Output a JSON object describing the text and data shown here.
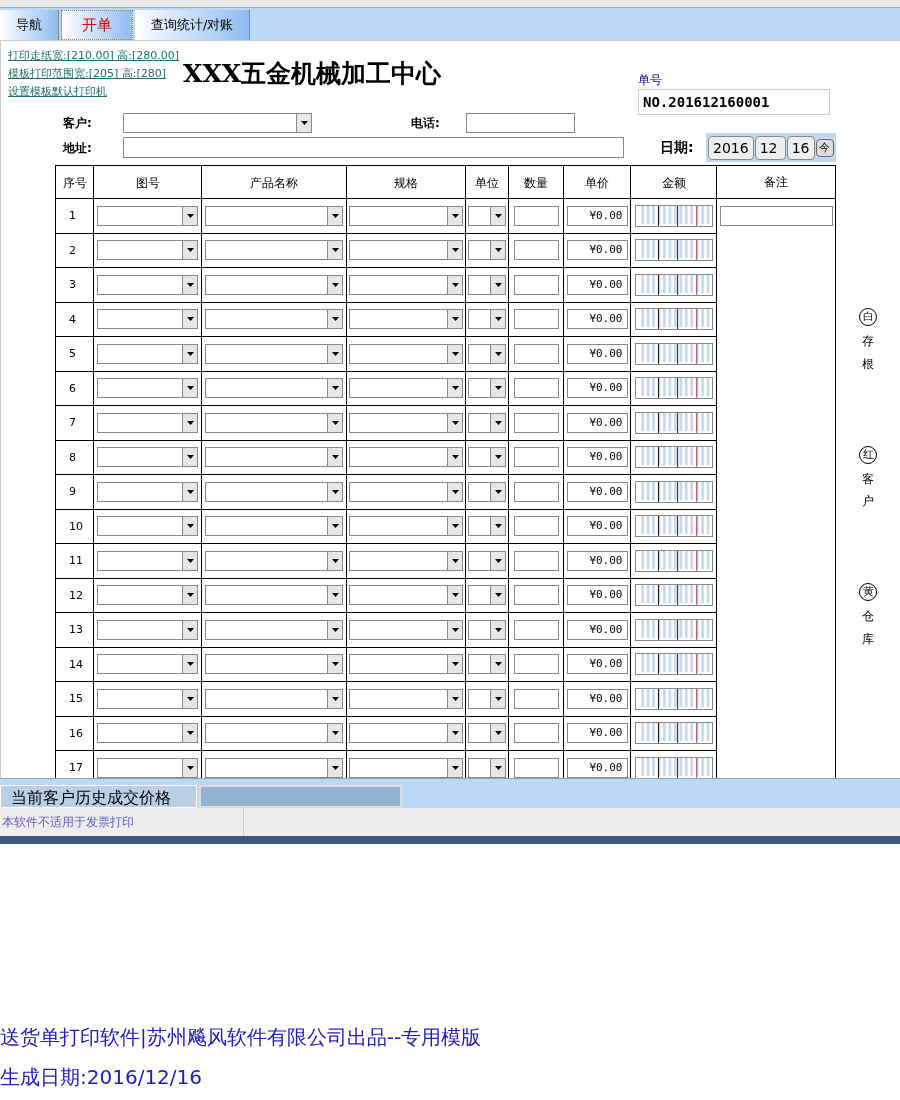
{
  "tabs": [
    {
      "label": "导航",
      "selected": false
    },
    {
      "label": "开单",
      "selected": true
    },
    {
      "label": "查询统计/对账",
      "selected": false
    }
  ],
  "print_links": [
    "打印走纸宽:[210.00] 高:[280.00]",
    "模板打印范围宽:[205] 高:[280]",
    "设置模板默认打印机"
  ],
  "title": "XXX五金机械加工中心",
  "order_no": {
    "label": "单号",
    "value": "NO.201612160001"
  },
  "customer": {
    "label": "客户:"
  },
  "phone": {
    "label": "电话:"
  },
  "address": {
    "label": "地址:"
  },
  "date": {
    "label": "日期:",
    "year": "2016",
    "month": "12",
    "day": "16",
    "today": "今"
  },
  "columns": [
    "序号",
    "图号",
    "产品名称",
    "规格",
    "单位",
    "数量",
    "单价",
    "金额",
    "备注"
  ],
  "rows": [
    {
      "no": "1",
      "price": "¥0.00"
    },
    {
      "no": "2",
      "price": "¥0.00"
    },
    {
      "no": "3",
      "price": "¥0.00"
    },
    {
      "no": "4",
      "price": "¥0.00"
    },
    {
      "no": "5",
      "price": "¥0.00"
    },
    {
      "no": "6",
      "price": "¥0.00"
    },
    {
      "no": "7",
      "price": "¥0.00"
    },
    {
      "no": "8",
      "price": "¥0.00"
    },
    {
      "no": "9",
      "price": "¥0.00"
    },
    {
      "no": "10",
      "price": "¥0.00"
    },
    {
      "no": "11",
      "price": "¥0.00"
    },
    {
      "no": "12",
      "price": "¥0.00"
    },
    {
      "no": "13",
      "price": "¥0.00"
    },
    {
      "no": "14",
      "price": "¥0.00"
    },
    {
      "no": "15",
      "price": "¥0.00"
    },
    {
      "no": "16",
      "price": "¥0.00"
    },
    {
      "no": "17",
      "price": "¥0.00"
    }
  ],
  "copies": [
    {
      "mark": "白",
      "label": "存根"
    },
    {
      "mark": "红",
      "label": "客户"
    },
    {
      "mark": "黄",
      "label": "仓库"
    }
  ],
  "history_tab": "当前客户历史成交价格",
  "status_text": "本软件不适用于发票打印",
  "footer": [
    "送货单打印软件|苏州飚风软件有限公司出品--专用模版",
    "生成日期:2016/12/16"
  ]
}
